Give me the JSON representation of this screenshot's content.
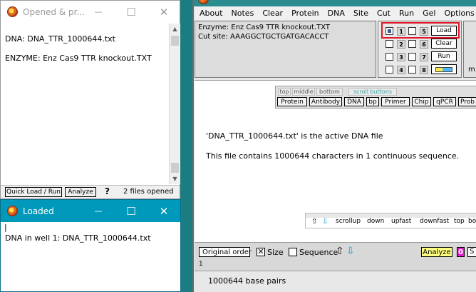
{
  "opened_window": {
    "title": "Opened & pr...",
    "minimize": "—",
    "maximize": "☐",
    "close": "✕",
    "lines": [
      "DNA: DNA_TTR_1000644.txt",
      "ENZYME: Enz Cas9 TTR knockout.TXT"
    ],
    "quick_load_label": "Quick Load / Run",
    "analyze_label": "Analyze",
    "help_label": "?",
    "status": "2  files opened"
  },
  "loaded_window": {
    "title": "Loaded",
    "minimize": "—",
    "maximize": "☐",
    "close": "✕",
    "cursor": "|",
    "line": "DNA in well 1:  DNA_TTR_1000644.txt"
  },
  "menubar": {
    "items": [
      "About",
      "Notes",
      "Clear",
      "Protein",
      "DNA",
      "Site",
      "Cut",
      "Run",
      "Gel",
      "Options"
    ]
  },
  "enzyme_panel": {
    "enzyme_line": "Enzyme: Enz Cas9 TTR knockout.TXT",
    "cut_site_line": "Cut site: AAAGGCTGCTGATGACACCT"
  },
  "wells": {
    "numbers": [
      "1",
      "2",
      "3",
      "4",
      "5",
      "6",
      "7",
      "8"
    ],
    "selected": "1",
    "load_label": "Load",
    "clear_label": "Clear",
    "run_label": "Run",
    "partial_label": "m"
  },
  "nav": {
    "tabs": [
      "top",
      "middle",
      "bottom"
    ],
    "scroll_tab": "scroll buttons",
    "buttons": [
      "Protein",
      "Antibody",
      "DNA",
      "bp",
      "Primer",
      "Chip",
      "qPCR",
      "Prob"
    ]
  },
  "main": {
    "active_file_line": "'DNA_TTR_1000644.txt' is the active DNA file",
    "content_line": "This file contains 1000644 characters in 1 continuous sequence."
  },
  "scrollbar": {
    "up_arrow": "⇧",
    "down_arrow": "⇩",
    "items": [
      "scrollup",
      "down",
      "upfast",
      "downfast",
      "top",
      "bo"
    ]
  },
  "bottom_toolbar": {
    "original_order": "Original order",
    "size_label": "Size",
    "sequence_label": "Sequence",
    "up_arrow": "⇧",
    "down_arrow": "⇩",
    "analyze_label": "Analyze",
    "zero_label": "0",
    "partial_label": "S",
    "line_number": "1"
  },
  "status_bar": {
    "text": "1000644 base pairs"
  },
  "colors": {
    "desktop": "#1b7d82",
    "loaded_titlebar": "#0099bc",
    "selection_red": "#e0182a",
    "analyze_yellow": "#ffff80"
  }
}
